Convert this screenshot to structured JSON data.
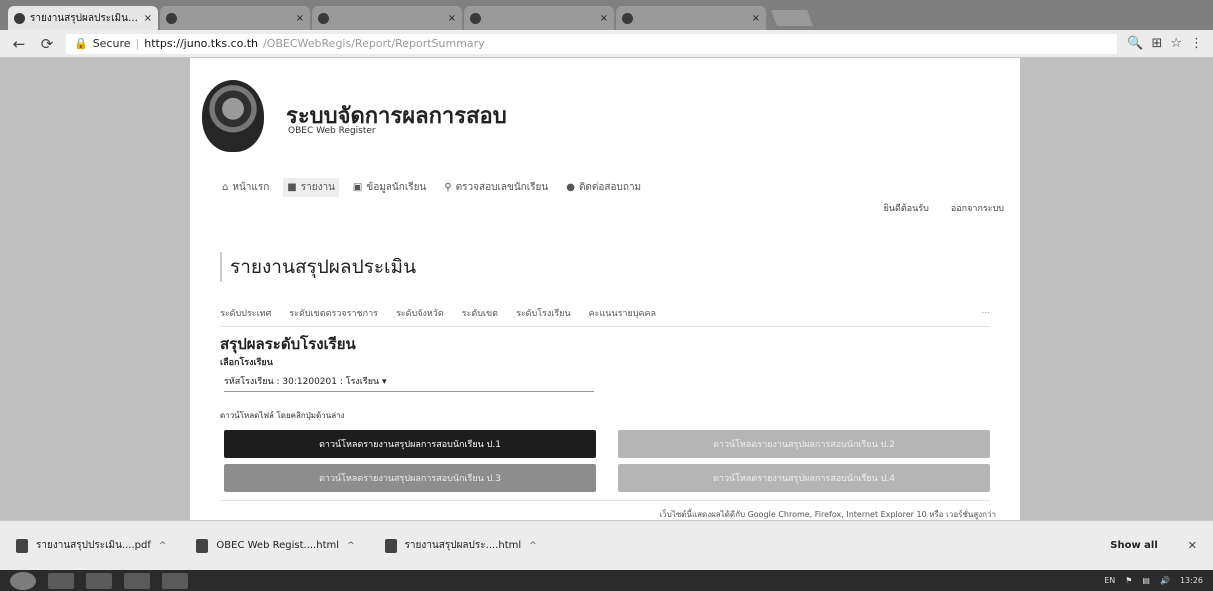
{
  "browser": {
    "tabs": [
      {
        "title": "รายงานสรุปผลประเมิน - Ch",
        "active": true
      },
      {
        "title": "",
        "active": false
      },
      {
        "title": "",
        "active": false
      },
      {
        "title": "",
        "active": false
      },
      {
        "title": "",
        "active": false
      }
    ],
    "secure_label": "Secure",
    "url_host": "https://juno.tks.co.th",
    "url_path": "/OBECWebRegis/Report/ReportSummary",
    "back_icon": "back-arrow-icon",
    "reload_icon": "reload-icon"
  },
  "site": {
    "title": "ระบบจัดการผลการสอบ",
    "subtitle": "OBEC Web Register"
  },
  "main_nav": [
    {
      "label": "หน้าแรก",
      "icon": "home-icon"
    },
    {
      "label": "รายงาน",
      "icon": "book-icon"
    },
    {
      "label": "ข้อมูลนักเรียน",
      "icon": "card-icon"
    },
    {
      "label": "ตรวจสอบเลขนักเรียน",
      "icon": "search-icon"
    },
    {
      "label": "ติดต่อสอบถาม",
      "icon": "info-icon"
    }
  ],
  "user_nav": {
    "welcome": "ยินดีต้อนรับ",
    "logout": "ออกจากระบบ"
  },
  "page_heading": "รายงานสรุปผลประเมิน",
  "sub_tabs": [
    "ระดับประเทศ",
    "ระดับเขตตรวจราชการ",
    "ระดับจังหวัด",
    "ระดับเขต",
    "ระดับโรงเรียน",
    "คะแนนรายบุคคล"
  ],
  "section": {
    "title": "สรุปผลระดับโรงเรียน",
    "select_label": "เลือกโรงเรียน",
    "select_value": "รหัสโรงเรียน : 30:1200201 : โรงเรียน",
    "download_hint": "ดาวน์โหลดไฟล์ โดยคลิกปุ่มด้านล่าง"
  },
  "buttons": {
    "b1": "ดาวน์โหลดรายงานสรุปผลการสอบนักเรียน ป.1",
    "b2": "ดาวน์โหลดรายงานสรุปผลการสอบนักเรียน ป.2",
    "b3": "ดาวน์โหลดรายงานสรุปผลการสอบนักเรียน ป.3",
    "b4": "ดาวน์โหลดรายงานสรุปผลการสอบนักเรียน ป.4"
  },
  "browser_note": "เว็บไซต์นี้แสดงผลได้ดีกับ Google Chrome, Firefox, Internet Explorer 10 หรือ เวอร์ชั่นสูงกว่า",
  "downloads": [
    {
      "label": "รายงานสรุปประเมิน....pdf"
    },
    {
      "label": "OBEC Web Regist....html"
    },
    {
      "label": "รายงานสรุปผลประ....html"
    }
  ],
  "downloads_show_all": "Show all",
  "tray": {
    "lang": "EN",
    "time": "13:26"
  }
}
